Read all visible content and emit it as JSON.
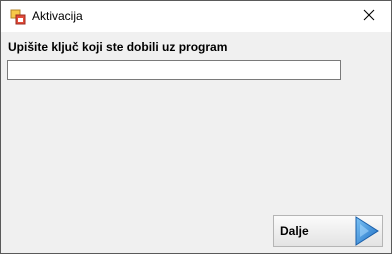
{
  "window": {
    "title": "Aktivacija",
    "icon": "app-window-icon",
    "close_icon": "close-icon"
  },
  "form": {
    "prompt_label": "Upišite ključ koji ste dobili uz program",
    "key_value": "",
    "key_placeholder": ""
  },
  "actions": {
    "next_label": "Dalje",
    "next_icon": "arrow-right-icon"
  },
  "colors": {
    "arrow_blue": "#3a8fd8",
    "background": "#f0f0f0"
  }
}
